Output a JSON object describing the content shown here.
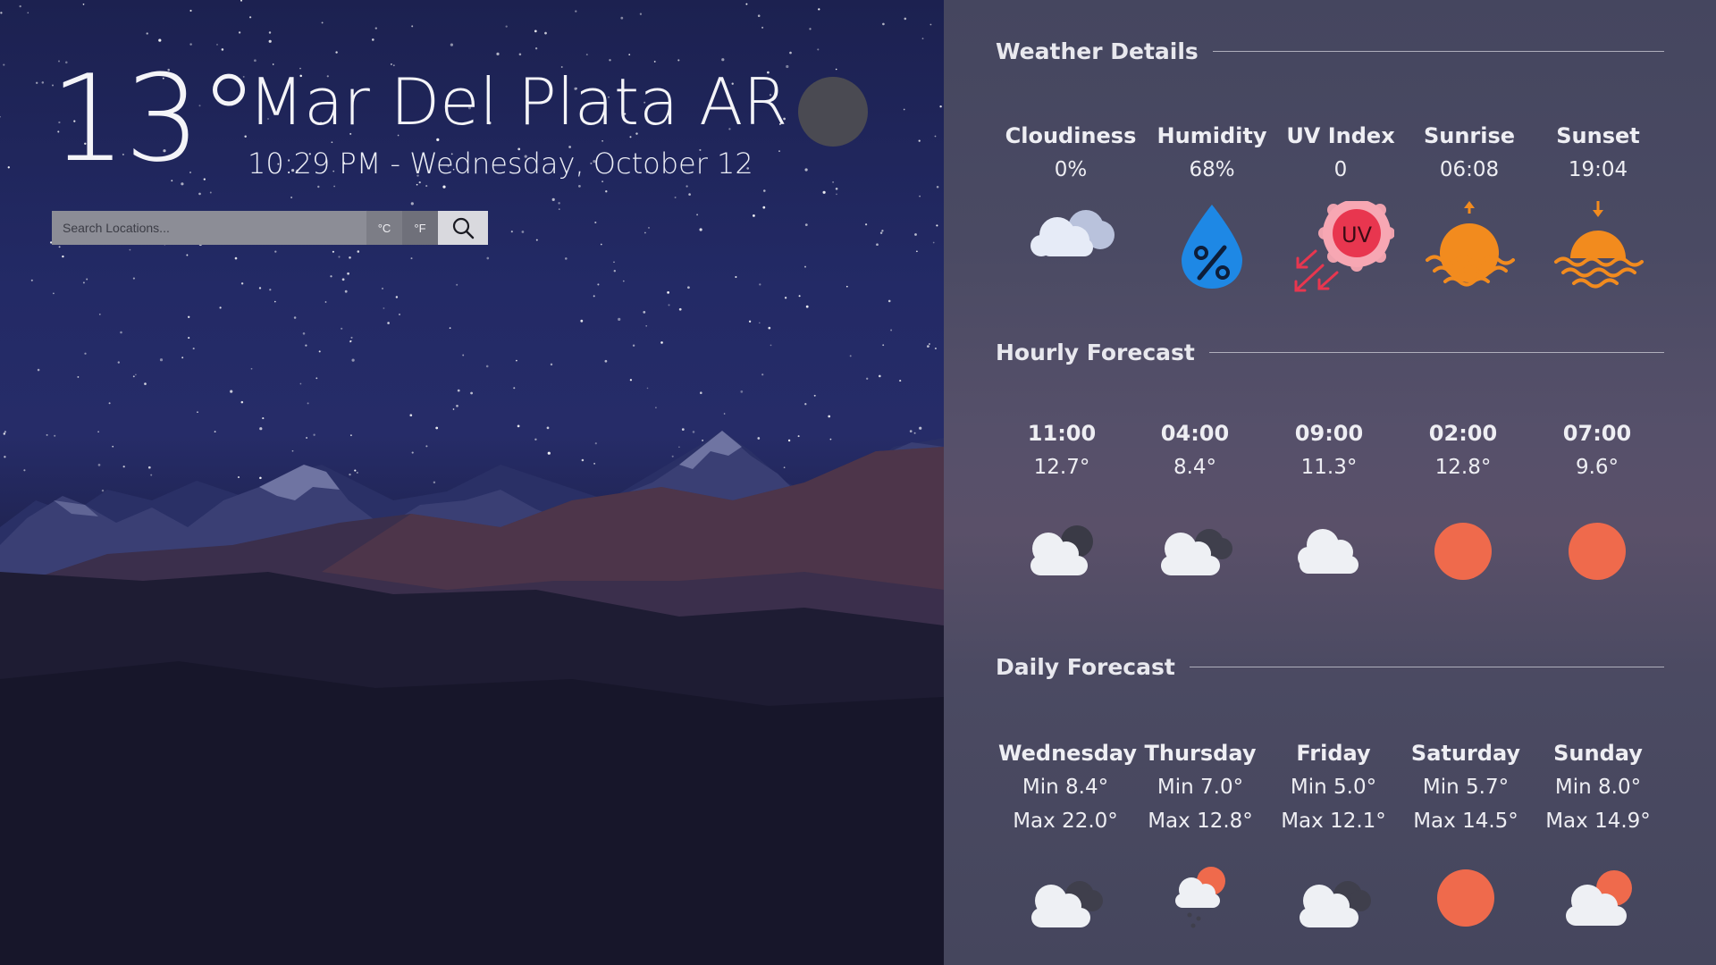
{
  "current": {
    "temperature": "13°",
    "location": "Mar Del Plata AR",
    "datetime": "10:29 PM - Wednesday, October 12",
    "condition_icon": "moon-icon"
  },
  "search": {
    "placeholder": "Search Locations...",
    "celsius_label": "°C",
    "fahrenheit_label": "°F",
    "search_icon": "search-icon"
  },
  "details": {
    "title": "Weather Details",
    "items": [
      {
        "label": "Cloudiness",
        "value": "0%",
        "icon": "clouds-icon"
      },
      {
        "label": "Humidity",
        "value": "68%",
        "icon": "humidity-drop-icon"
      },
      {
        "label": "UV Index",
        "value": "0",
        "icon": "uv-icon",
        "icon_text": "UV"
      },
      {
        "label": "Sunrise",
        "value": "06:08",
        "icon": "sunrise-icon"
      },
      {
        "label": "Sunset",
        "value": "19:04",
        "icon": "sunset-icon"
      }
    ]
  },
  "hourly": {
    "title": "Hourly Forecast",
    "items": [
      {
        "time": "11:00",
        "temp": "12.7°",
        "icon": "cloud-night-icon"
      },
      {
        "time": "04:00",
        "temp": "8.4°",
        "icon": "cloud-night-icon"
      },
      {
        "time": "09:00",
        "temp": "11.3°",
        "icon": "cloud-icon"
      },
      {
        "time": "02:00",
        "temp": "12.8°",
        "icon": "sun-icon"
      },
      {
        "time": "07:00",
        "temp": "9.6°",
        "icon": "sun-icon"
      }
    ]
  },
  "daily": {
    "title": "Daily Forecast",
    "items": [
      {
        "day": "Wednesday",
        "min": "Min 8.4°",
        "max": "Max 22.0°",
        "icon": "cloud-night-icon"
      },
      {
        "day": "Thursday",
        "min": "Min 7.0°",
        "max": "Max 12.8°",
        "icon": "rain-sun-cloud-icon"
      },
      {
        "day": "Friday",
        "min": "Min 5.0°",
        "max": "Max 12.1°",
        "icon": "cloud-night-icon"
      },
      {
        "day": "Saturday",
        "min": "Min 5.7°",
        "max": "Max 14.5°",
        "icon": "sun-icon"
      },
      {
        "day": "Sunday",
        "min": "Min 8.0°",
        "max": "Max 14.9°",
        "icon": "partly-cloudy-icon"
      }
    ]
  },
  "colors": {
    "sun": "#ef6a4c",
    "orange": "#f28b1e",
    "humidity_blue": "#1e88e5",
    "uv_pink": "#e8364f"
  }
}
